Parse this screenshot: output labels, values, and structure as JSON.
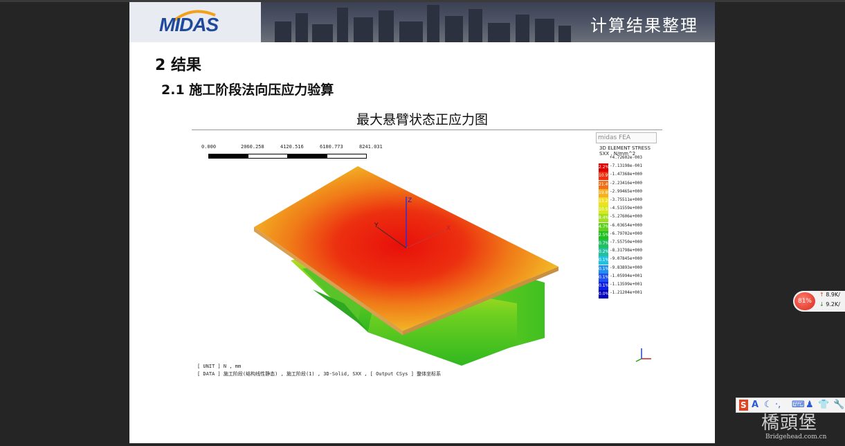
{
  "slide": {
    "logo": "MIDAS",
    "banner_title": "计算结果整理",
    "heading1": "2 结果",
    "heading2": "2.1  施工阶段法向压应力验算",
    "figure_caption": "最大悬臂状态正应力图"
  },
  "figure": {
    "scale_labels": [
      "0.000",
      "2060.258",
      "4120.516",
      "6180.773",
      "8241.031"
    ],
    "watermark": "midas FEA",
    "legend_title": [
      "3D ELEMENT STRESS",
      "SXX , N/mm^2"
    ],
    "legend": [
      {
        "pct": "",
        "value": "+4.72602e-003",
        "color": "#ffffff"
      },
      {
        "pct": "2.2%",
        "value": "-7.13198e-001",
        "color": "#e10000"
      },
      {
        "pct": "10.9%",
        "value": "-1.47368e+000",
        "color": "#f03010"
      },
      {
        "pct": "21.4%",
        "value": "-2.23416e+000",
        "color": "#f07018"
      },
      {
        "pct": "19.8%",
        "value": "-2.99465e+000",
        "color": "#f6b020"
      },
      {
        "pct": "13.2%",
        "value": "-3.75511e+000",
        "color": "#f0e020"
      },
      {
        "pct": "10.5%",
        "value": "-4.51559e+000",
        "color": "#d8e820"
      },
      {
        "pct": "8.4%",
        "value": "-5.27606e+000",
        "color": "#a0e020"
      },
      {
        "pct": "4.7%",
        "value": "-6.03654e+000",
        "color": "#60d020"
      },
      {
        "pct": "2.5%",
        "value": "-6.79702e+000",
        "color": "#20c020"
      },
      {
        "pct": "0.7%",
        "value": "-7.55750e+000",
        "color": "#20c060"
      },
      {
        "pct": "0.2%",
        "value": "-8.31798e+000",
        "color": "#20c0a0"
      },
      {
        "pct": "0.1%",
        "value": "-9.07845e+000",
        "color": "#20c0e0"
      },
      {
        "pct": "0.1%",
        "value": "-9.83893e+000",
        "color": "#2090f0"
      },
      {
        "pct": "0.1%",
        "value": "-1.05994e+001",
        "color": "#2050f0"
      },
      {
        "pct": "0.1%",
        "value": "-1.13599e+001",
        "color": "#1020e0"
      },
      {
        "pct": "0.0%",
        "value": "-1.21204e+001",
        "color": "#0000c0"
      }
    ],
    "info_line1": "[ UNIT ]  N ,  mm",
    "info_line2": "[ DATA ]  施工阶段(结构线性静态) ,  施工阶段(1) ,  3D-Solid, SXX ,  [ Output CSys ]  整体坐标系",
    "axis": {
      "x": "X",
      "y": "Y",
      "z": "Z"
    }
  },
  "network_widget": {
    "percent": "81%",
    "up": "8.9K/",
    "down": "9.2K/"
  },
  "ime_toolbar": {
    "s_icon": "S",
    "letter": "A"
  },
  "site_watermark": {
    "name": "橋頭堡",
    "url": "Bridgehead.com.cn"
  },
  "colors": {
    "background": "#252525",
    "slide": "#ffffff",
    "logo_blue": "#1f4a9c"
  }
}
